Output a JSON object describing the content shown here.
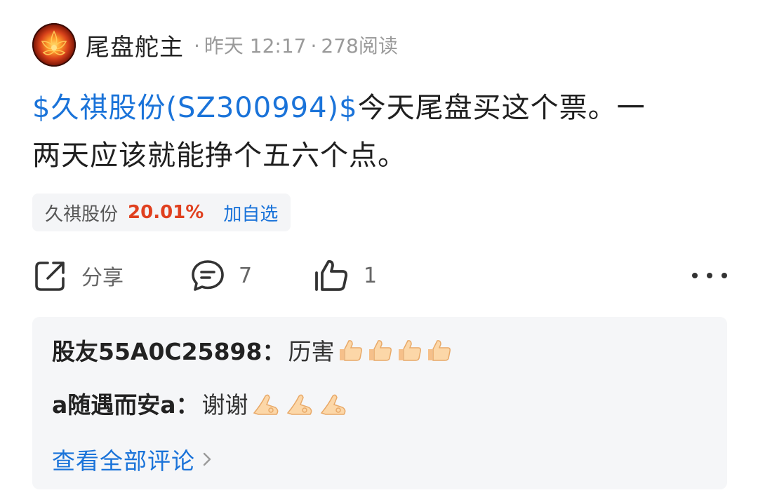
{
  "author": {
    "name": "尾盘舵主",
    "avatar_icon": "lotus-flame-avatar"
  },
  "meta": {
    "separator": "·",
    "time": "昨天 12:17",
    "reads": "278阅读"
  },
  "post": {
    "stock_tag": "$久祺股份(SZ300994)$",
    "line1_text": "今天尾盘买这个票。一",
    "line2_text": "两天应该就能挣个五六个点。"
  },
  "stock_chip": {
    "name": "久祺股份",
    "change": "20.01%",
    "add_label": "加自选"
  },
  "actions": {
    "share_label": "分享",
    "share_icon": "share-icon",
    "comment_count": "7",
    "comment_icon": "comment-icon",
    "like_count": "1",
    "like_icon": "thumbs-up-icon",
    "more_icon": "more-dots-icon"
  },
  "comments": [
    {
      "user": "股友55A0C25898",
      "colon": "：",
      "text": "历害",
      "emoji": "thumbs-up-emoji",
      "emoji_count": 4
    },
    {
      "user": "a随遇而安a",
      "colon": "：",
      "text": "谢谢",
      "emoji": "ok-hand-emoji",
      "emoji_count": 3
    }
  ],
  "view_all": {
    "label": "查看全部评论",
    "chevron": "›"
  },
  "colors": {
    "link_blue": "#1a73d9",
    "rise_red": "#e0401f",
    "meta_gray": "#9a9a9a",
    "panel_bg": "#f5f6f8"
  }
}
